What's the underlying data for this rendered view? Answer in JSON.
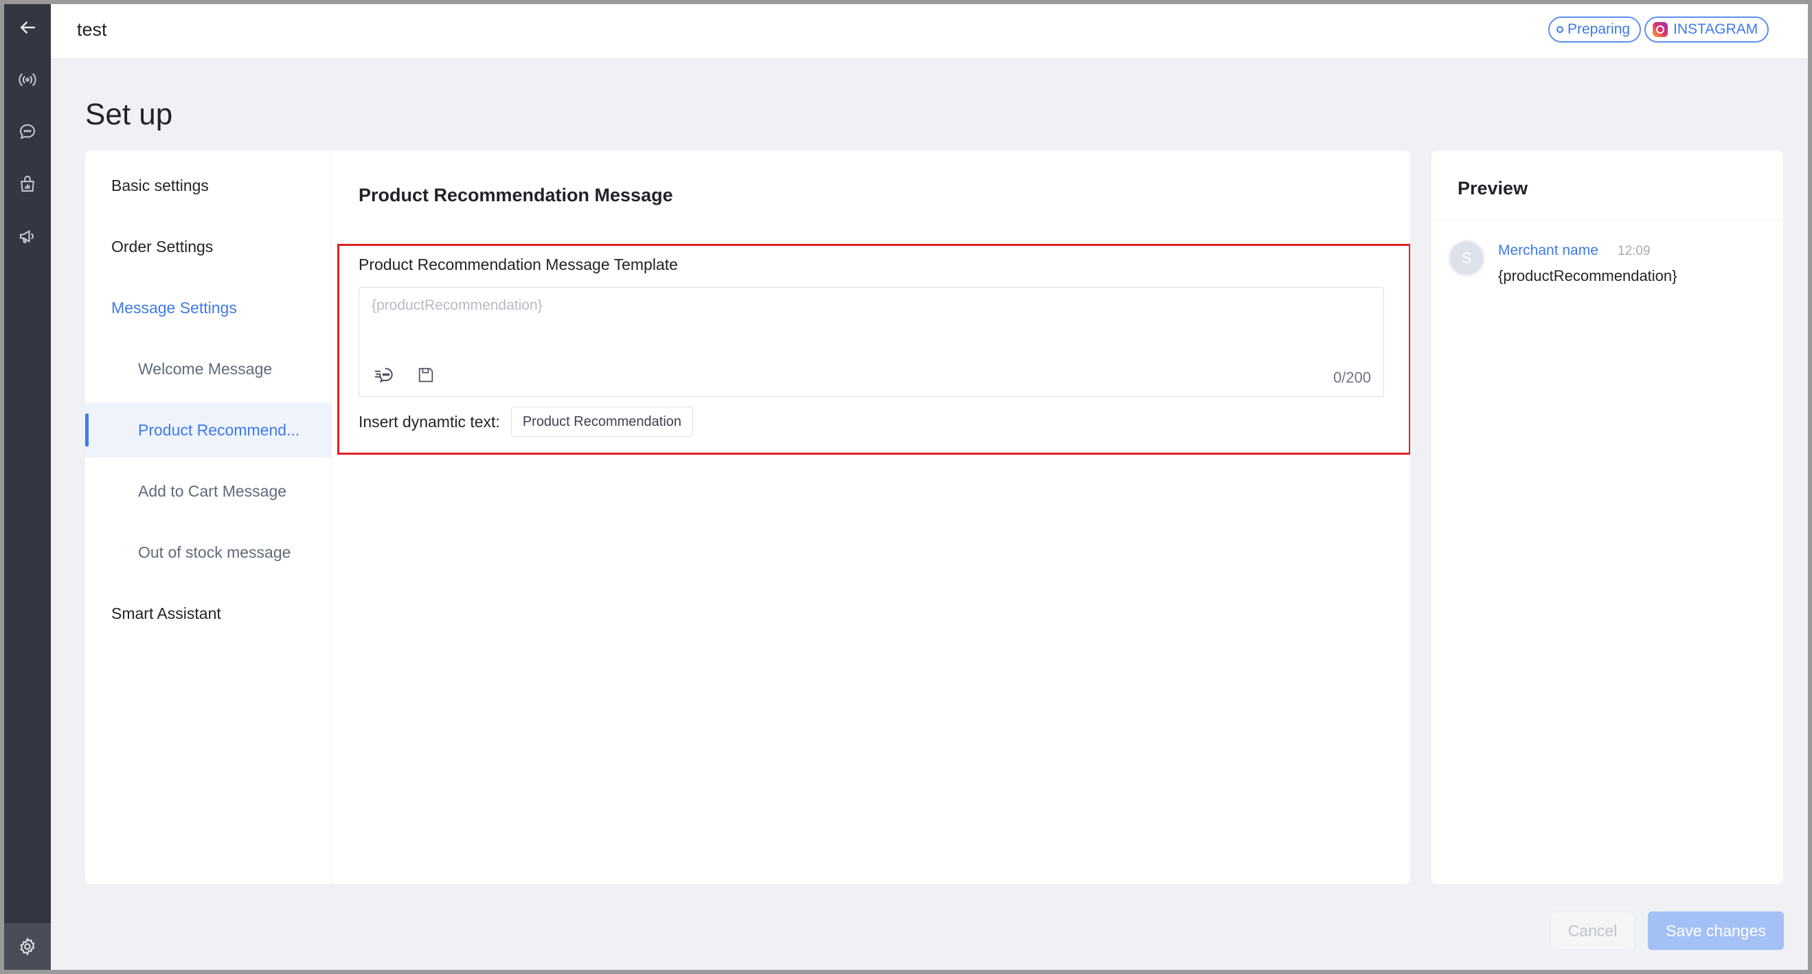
{
  "topbar": {
    "title": "test",
    "status_badge": "Preparing",
    "channel_badge": "INSTAGRAM"
  },
  "page": {
    "title": "Set up"
  },
  "nav": {
    "basic_settings": "Basic settings",
    "order_settings": "Order Settings",
    "message_settings": "Message Settings",
    "welcome_message": "Welcome Message",
    "product_recommendation": "Product Recommend...",
    "add_to_cart": "Add to Cart Message",
    "out_of_stock": "Out of stock message",
    "smart_assistant": "Smart Assistant"
  },
  "content": {
    "section_title": "Product Recommendation Message",
    "field_label": "Product Recommendation Message Template",
    "placeholder": "{productRecommendation}",
    "char_count": "0/200",
    "insert_label": "Insert dynamtic text:",
    "insert_chip": "Product Recommendation"
  },
  "preview": {
    "title": "Preview",
    "avatar_letter": "S",
    "merchant_name": "Merchant name",
    "time": "12:09",
    "message": "{productRecommendation}"
  },
  "footer": {
    "cancel_label": "Cancel",
    "save_label": "Save changes"
  },
  "colors": {
    "accent": "#3f7ae8",
    "rail": "#343741",
    "highlight": "#e02020"
  }
}
